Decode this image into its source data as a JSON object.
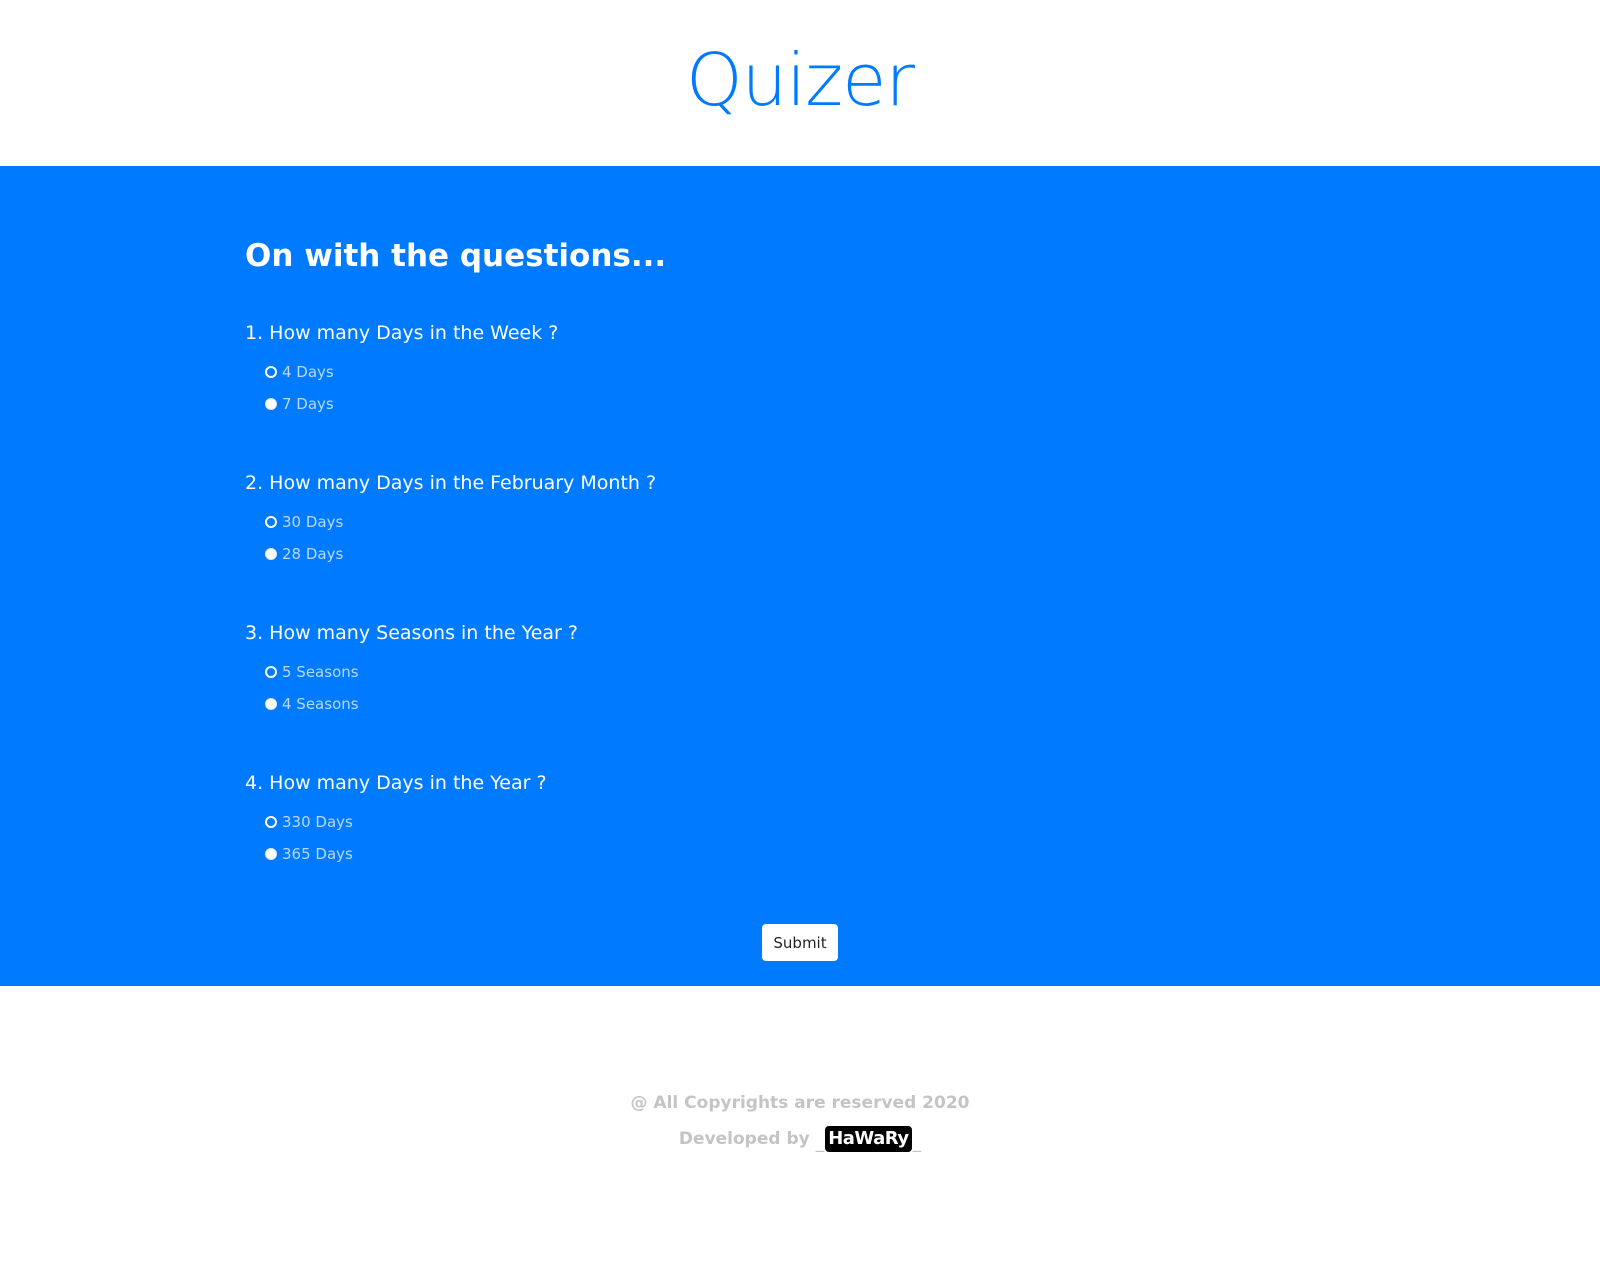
{
  "header": {
    "brand": "Quizer",
    "brand_color": "#007bff"
  },
  "quiz": {
    "background": "#007bff",
    "heading": "On with the questions...",
    "questions": [
      {
        "title": "1. How many Days in the Week ?",
        "options": [
          {
            "label": "4 Days",
            "radio": "ring"
          },
          {
            "label": "7 Days",
            "radio": "dot"
          }
        ]
      },
      {
        "title": "2. How many Days in the February Month ?",
        "options": [
          {
            "label": "30 Days",
            "radio": "ring"
          },
          {
            "label": "28 Days",
            "radio": "dot"
          }
        ]
      },
      {
        "title": "3. How many Seasons in the Year ?",
        "options": [
          {
            "label": "5 Seasons",
            "radio": "ring"
          },
          {
            "label": "4 Seasons",
            "radio": "dot"
          }
        ]
      },
      {
        "title": "4. How many Days in the Year ?",
        "options": [
          {
            "label": "330 Days",
            "radio": "ring"
          },
          {
            "label": "365 Days",
            "radio": "dot"
          }
        ]
      }
    ],
    "submit_label": "Submit"
  },
  "footer": {
    "copyright": "@ All Copyrights are reserved 2020",
    "developed_prefix": "Developed by",
    "developer_name": "HaWaRy",
    "underscore": "_"
  }
}
